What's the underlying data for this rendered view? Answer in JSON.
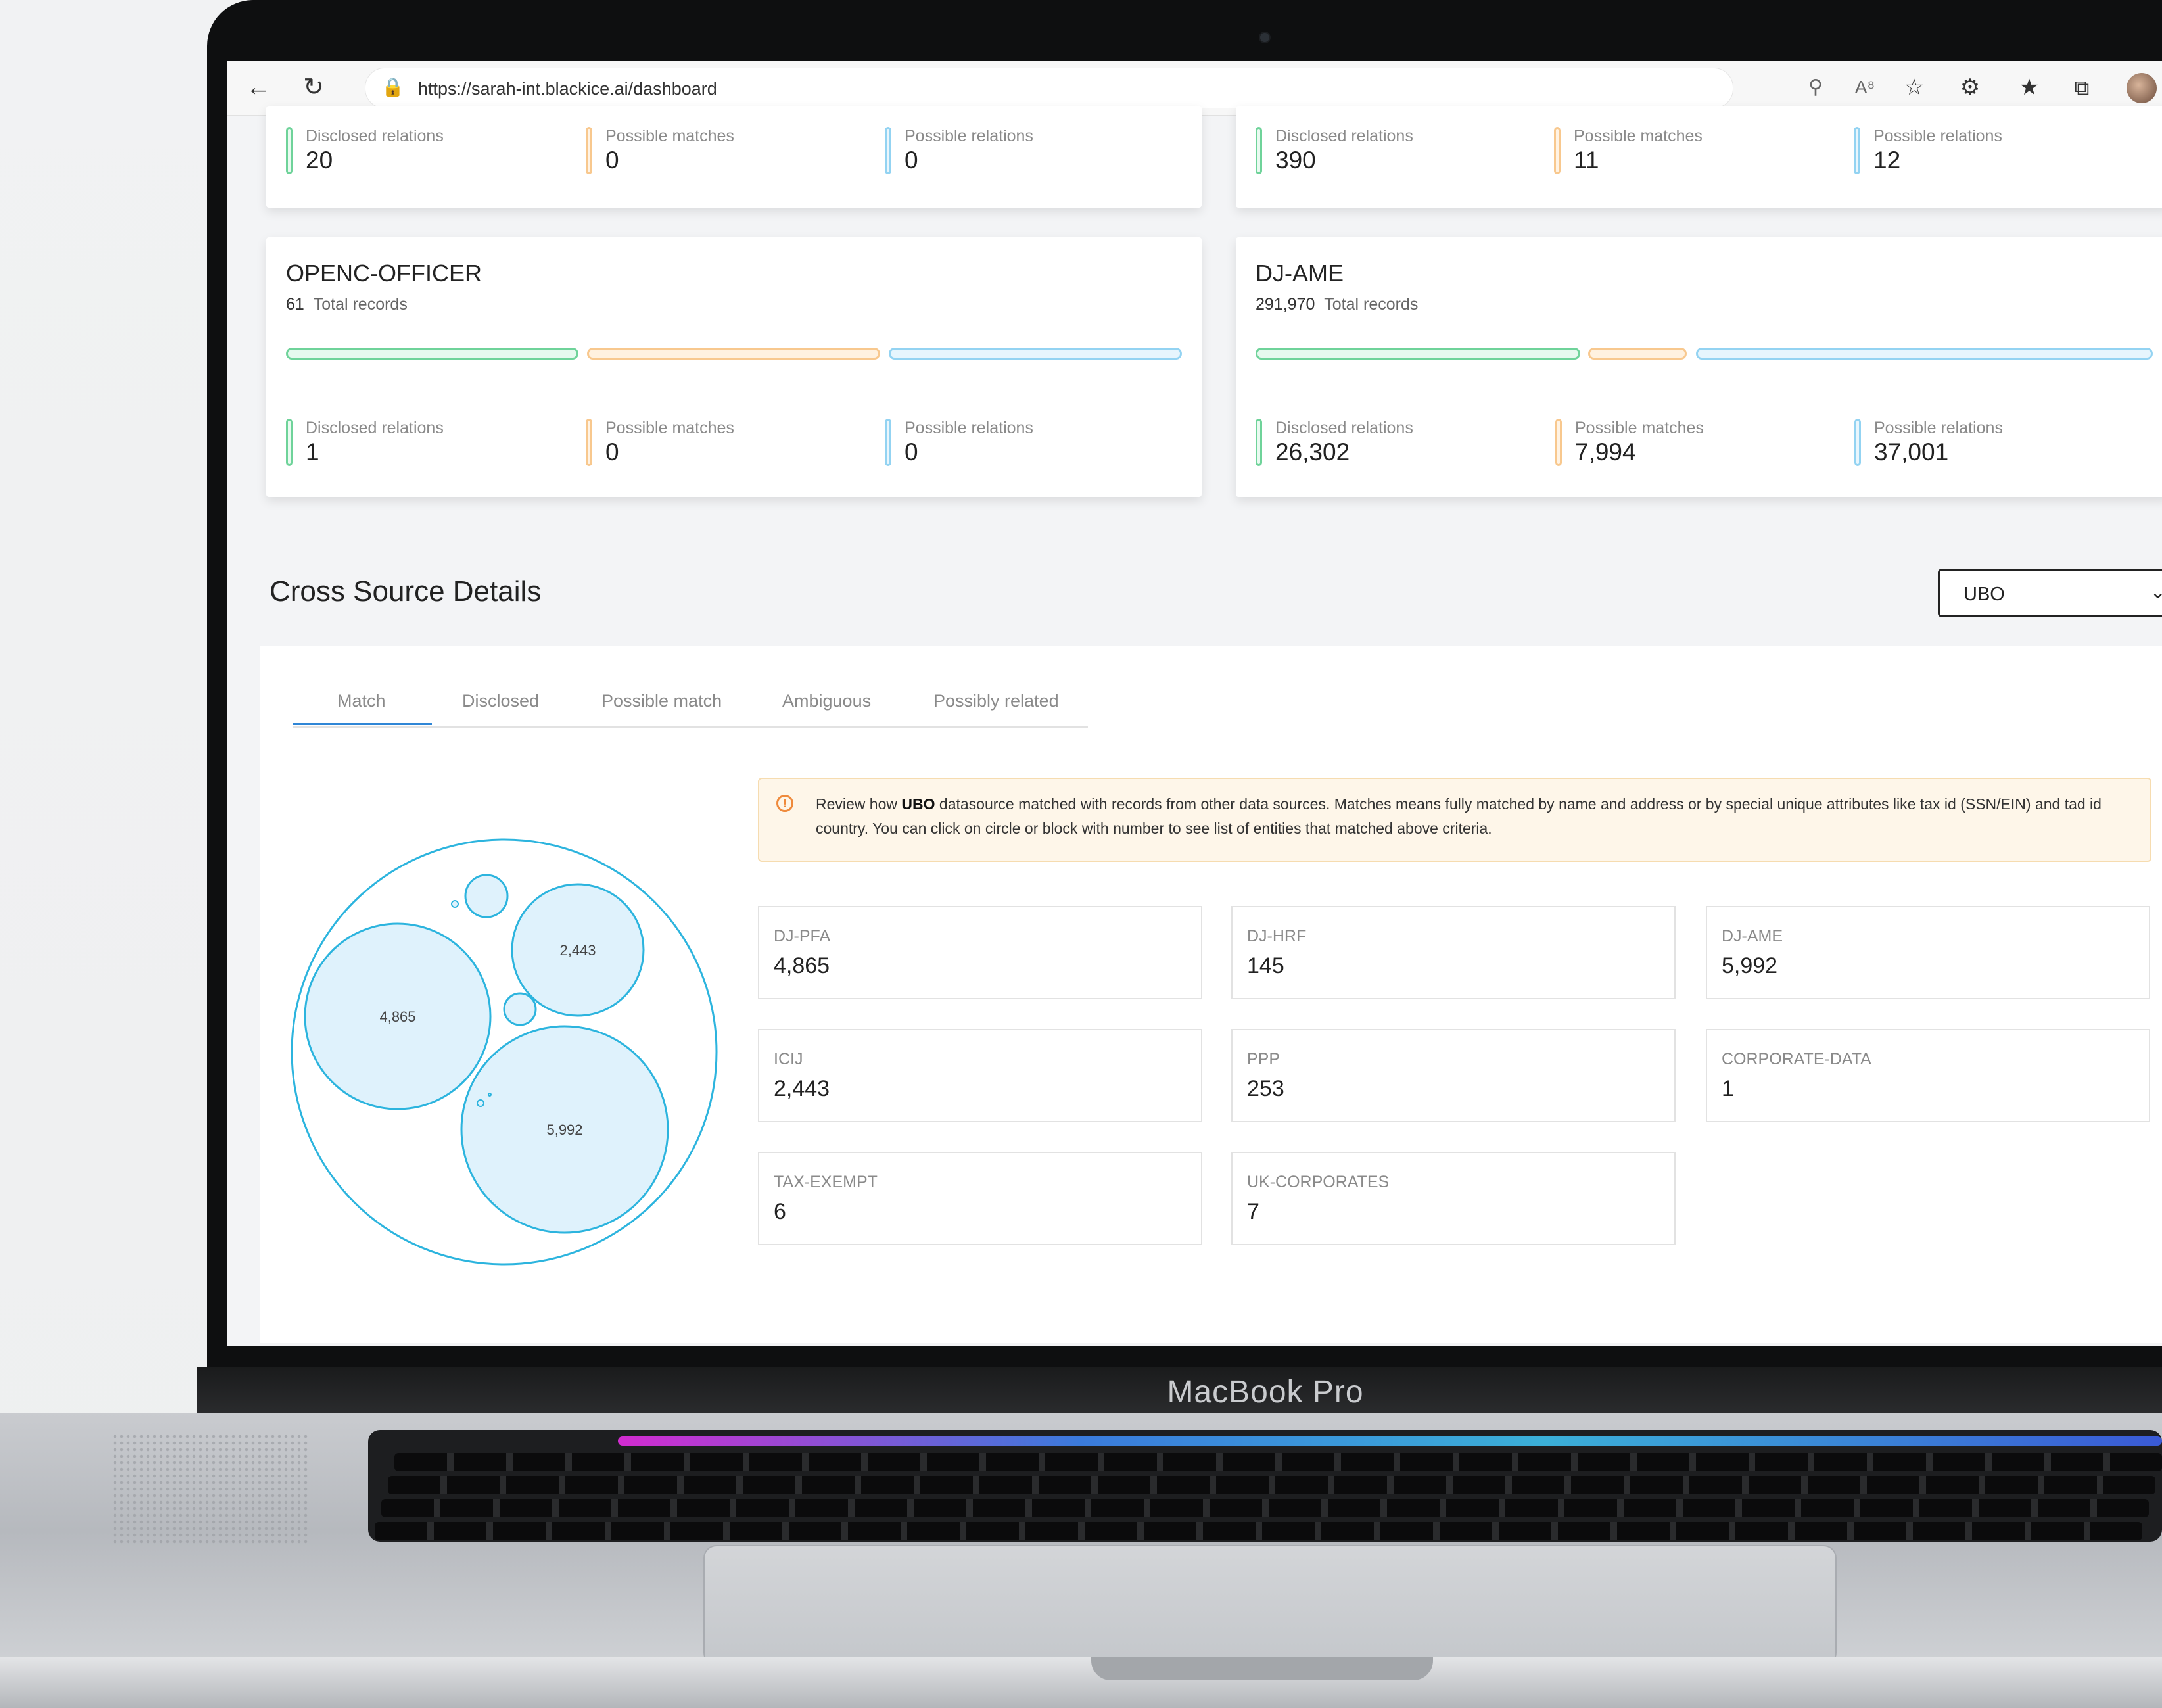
{
  "device": {
    "brand": "MacBook Pro"
  },
  "browser": {
    "url": "https://sarah-int.blackice.ai/dashboard",
    "icons": [
      "back-icon",
      "reload-icon",
      "lock-icon",
      "key-icon",
      "read-aloud-icon",
      "favorite-add-icon",
      "extensions-icon",
      "favorites-icon",
      "collections-icon",
      "profile-avatar"
    ]
  },
  "cards": {
    "top_left": {
      "stats": [
        {
          "label": "Disclosed relations",
          "value": "20"
        },
        {
          "label": "Possible matches",
          "value": "0"
        },
        {
          "label": "Possible relations",
          "value": "0"
        }
      ]
    },
    "top_right": {
      "stats": [
        {
          "label": "Disclosed relations",
          "value": "390"
        },
        {
          "label": "Possible matches",
          "value": "11"
        },
        {
          "label": "Possible relations",
          "value": "12"
        }
      ]
    },
    "openc": {
      "title": "OPENC-OFFICER",
      "total": "61",
      "total_label": "Total records",
      "stats": [
        {
          "label": "Disclosed relations",
          "value": "1"
        },
        {
          "label": "Possible matches",
          "value": "0"
        },
        {
          "label": "Possible relations",
          "value": "0"
        }
      ]
    },
    "djame": {
      "title": "DJ-AME",
      "total": "291,970",
      "total_label": "Total records",
      "stats": [
        {
          "label": "Disclosed relations",
          "value": "26,302"
        },
        {
          "label": "Possible matches",
          "value": "7,994"
        },
        {
          "label": "Possible relations",
          "value": "37,001"
        }
      ]
    }
  },
  "cross_source": {
    "title": "Cross Source Details",
    "selected_source": "UBO",
    "tabs": [
      "Match",
      "Disclosed",
      "Possible match",
      "Ambiguous",
      "Possibly related"
    ],
    "active_tab": "Match",
    "alert": {
      "prefix": "Review how ",
      "source": "UBO",
      "rest": " datasource matched with records from other data sources. Matches means fully matched by name and address or by special unique attributes like tax id (SSN/EIN) and tad id country. You can click on circle or block with number to see list of entities that matched above criteria."
    },
    "tiles": [
      {
        "name": "DJ-PFA",
        "value": "4,865"
      },
      {
        "name": "DJ-HRF",
        "value": "145"
      },
      {
        "name": "DJ-AME",
        "value": "5,992"
      },
      {
        "name": "ICIJ",
        "value": "2,443"
      },
      {
        "name": "PPP",
        "value": "253"
      },
      {
        "name": "CORPORATE-DATA",
        "value": "1"
      },
      {
        "name": "TAX-EXEMPT",
        "value": "6"
      },
      {
        "name": "UK-CORPORATES",
        "value": "7"
      }
    ],
    "bubble_labels": {
      "djpfa": "4,865",
      "icij": "2,443",
      "djame": "5,992"
    }
  },
  "colors": {
    "green": "#6fd39a",
    "orange": "#f8c88e",
    "blue": "#93d3f2",
    "bubble_fill": "#dff2fc",
    "bubble_stroke": "#2cb4de",
    "tab_active": "#2f86d6"
  }
}
